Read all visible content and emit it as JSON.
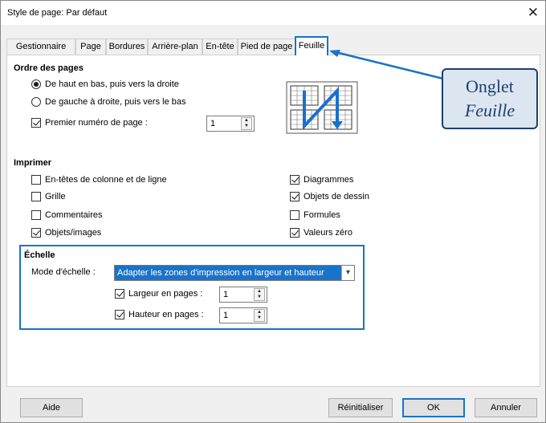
{
  "window": {
    "title": "Style de page: Par défaut"
  },
  "tabs": [
    {
      "label": "Gestionnaire"
    },
    {
      "label": "Page"
    },
    {
      "label": "Bordures"
    },
    {
      "label": "Arrière-plan"
    },
    {
      "label": "En-tête"
    },
    {
      "label": "Pied de page"
    },
    {
      "label": "Feuille"
    }
  ],
  "order": {
    "title": "Ordre des pages",
    "opt1": "De haut en bas, puis vers la droite",
    "opt2": "De gauche à droite, puis vers le bas",
    "first_page_label": "Premier numéro de page :",
    "first_page_value": "1"
  },
  "print": {
    "title": "Imprimer",
    "left": [
      {
        "label": "En-têtes de colonne et de ligne",
        "checked": false
      },
      {
        "label": "Grille",
        "checked": false
      },
      {
        "label": "Commentaires",
        "checked": false
      },
      {
        "label": "Objets/images",
        "checked": true
      }
    ],
    "right": [
      {
        "label": "Diagrammes",
        "checked": true
      },
      {
        "label": "Objets de dessin",
        "checked": true
      },
      {
        "label": "Formules",
        "checked": false
      },
      {
        "label": "Valeurs zéro",
        "checked": true
      }
    ]
  },
  "scale": {
    "title": "Échelle",
    "mode_label": "Mode d'échelle :",
    "mode_value": "Adapter les zones d'impression en largeur et hauteur",
    "width_label": "Largeur en pages :",
    "width_value": "1",
    "height_label": "Hauteur en pages :",
    "height_value": "1"
  },
  "callout": {
    "line1": "Onglet",
    "line2": "Feuille"
  },
  "buttons": {
    "help": "Aide",
    "reset": "Réinitialiser",
    "ok": "OK",
    "cancel": "Annuler"
  }
}
